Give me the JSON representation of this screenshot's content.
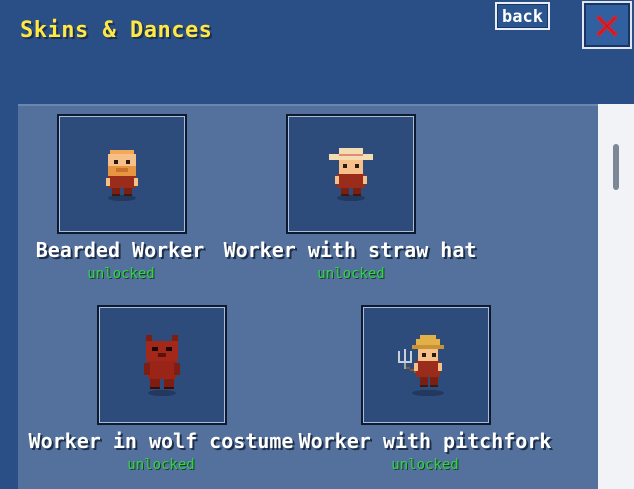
{
  "header": {
    "title": "Skins & Dances",
    "back_label": "back",
    "close_icon": "close-x-icon"
  },
  "skins": [
    {
      "name": "Bearded Worker",
      "status": "unlocked",
      "icon": "bearded-worker-sprite"
    },
    {
      "name": "Worker with straw hat",
      "status": "unlocked",
      "icon": "straw-hat-worker-sprite"
    },
    {
      "name": "Worker in wolf costume",
      "status": "unlocked",
      "icon": "wolf-costume-worker-sprite"
    },
    {
      "name": "Worker with pitchfork",
      "status": "unlocked",
      "icon": "pitchfork-worker-sprite"
    }
  ],
  "colors": {
    "background": "#2a4f86",
    "panel": "#53719c",
    "title": "#ffe843",
    "status_unlocked": "#2fd64a",
    "close_x": "#e0202a"
  }
}
